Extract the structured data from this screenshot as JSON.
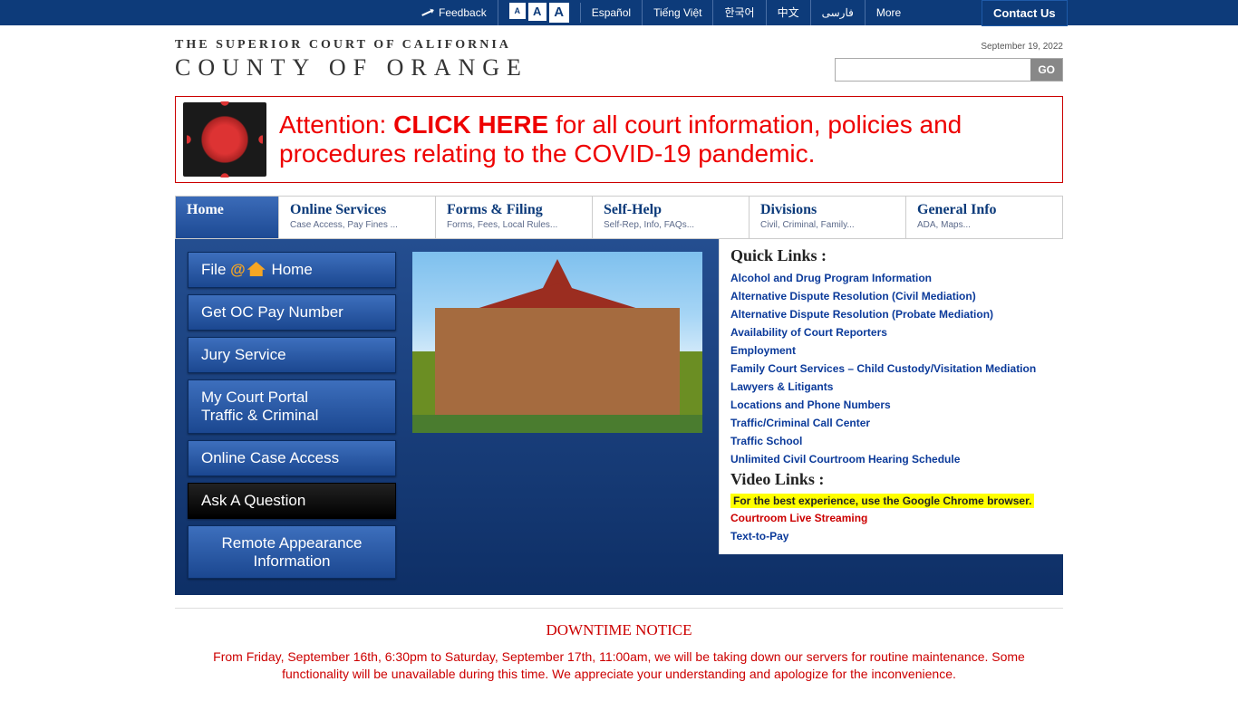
{
  "topbar": {
    "feedback": "Feedback",
    "espanol": "Español",
    "tiengviet": "Tiếng Việt",
    "korean": "한국어",
    "chinese": "中文",
    "farsi": "فارسی",
    "more": "More",
    "contact": "Contact Us",
    "font_sm": "A",
    "font_md": "A",
    "font_lg": "A"
  },
  "header": {
    "logo_top": "THE SUPERIOR COURT OF CALIFORNIA",
    "logo_bottom": "COUNTY OF ORANGE",
    "date": "September 19, 2022",
    "go": "GO"
  },
  "covid": {
    "prefix": "Attention: ",
    "bold": "CLICK HERE",
    "suffix": " for all court information, policies and procedures relating to the COVID-19 pandemic."
  },
  "nav": {
    "home": "Home",
    "online_t": "Online Services",
    "online_s": "Case Access, Pay Fines ...",
    "forms_t": "Forms & Filing",
    "forms_s": "Forms, Fees, Local Rules...",
    "self_t": "Self-Help",
    "self_s": "Self-Rep, Info, FAQs...",
    "div_t": "Divisions",
    "div_s": "Civil, Criminal, Family...",
    "gen_t": "General Info",
    "gen_s": "ADA, Maps..."
  },
  "side": {
    "file_at_home_p1": "File",
    "file_at_home_at": "@",
    "file_at_home_p2": "Home",
    "ocpay": "Get OC Pay Number",
    "jury": "Jury Service",
    "portal_l1": "My Court Portal",
    "portal_l2": "Traffic & Criminal",
    "caseaccess": "Online Case Access",
    "ask": "Ask A Question",
    "remote_l1": "Remote Appearance",
    "remote_l2": "Information"
  },
  "links": {
    "quick_header": "Quick Links :",
    "q": [
      "Alcohol and Drug Program Information",
      "Alternative Dispute Resolution (Civil Mediation)",
      "Alternative Dispute Resolution (Probate Mediation)",
      "Availability of Court Reporters",
      "Employment",
      "Family Court Services – Child Custody/Visitation Mediation",
      "Lawyers & Litigants",
      "Locations and Phone Numbers",
      "Traffic/Criminal Call Center",
      "Traffic School",
      "Unlimited Civil Courtroom Hearing Schedule"
    ],
    "video_header": "Video Links :",
    "yellow": "For the best experience, use the Google Chrome browser.",
    "live": "Courtroom Live Streaming",
    "ttp": "Text-to-Pay"
  },
  "notice": {
    "title": "DOWNTIME NOTICE",
    "body": "From Friday, September 16th, 6:30pm to Saturday, September 17th, 11:00am, we will be taking down our servers for routine maintenance. Some functionality will be unavailable during this time. We appreciate your understanding and apologize for the inconvenience."
  }
}
